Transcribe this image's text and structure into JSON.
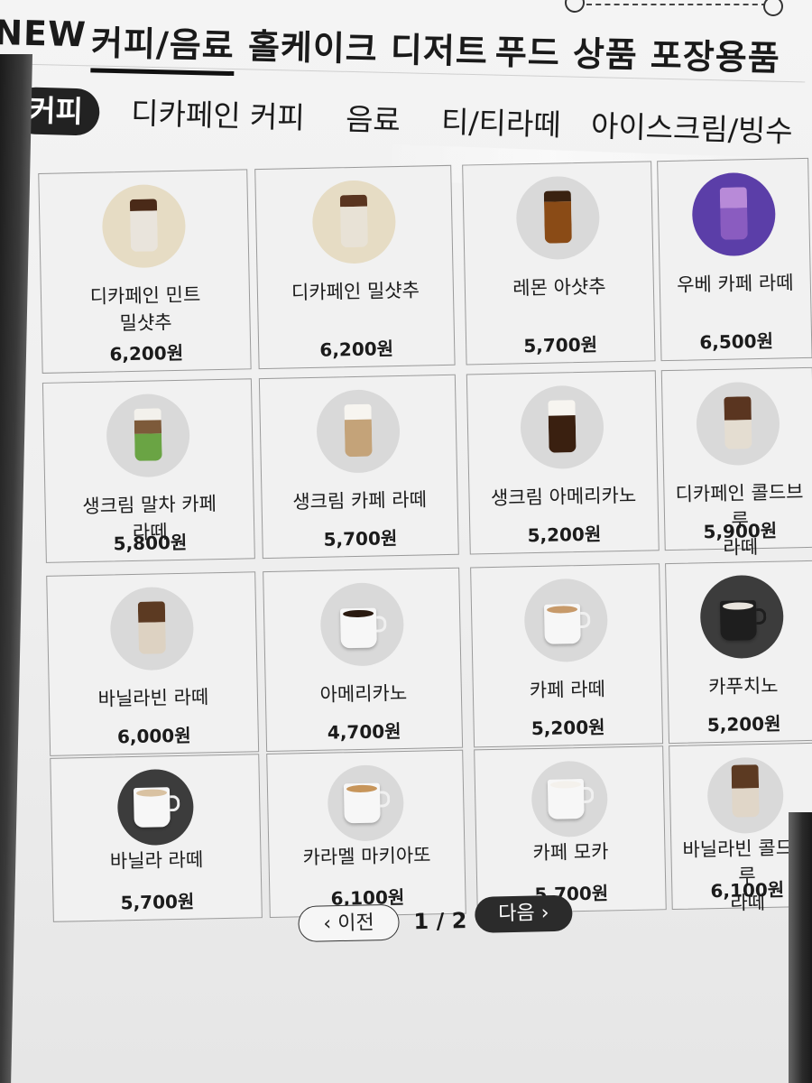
{
  "top_nav": {
    "items": [
      {
        "label": "NEW"
      },
      {
        "label": "커피/음료",
        "active": true
      },
      {
        "label": "홀케이크"
      },
      {
        "label": "디저트"
      },
      {
        "label": "푸드"
      },
      {
        "label": "상품"
      },
      {
        "label": "포장용품"
      }
    ]
  },
  "sub_nav": {
    "items": [
      {
        "label": "커피",
        "active": true
      },
      {
        "label": "디카페인 커피"
      },
      {
        "label": "음료"
      },
      {
        "label": "티/티라떼"
      },
      {
        "label": "아이스크림/빙수"
      }
    ]
  },
  "products": [
    {
      "name_lines": [
        "디카페인 민트",
        "밀샷추"
      ],
      "price": "6,200원",
      "icon": "iced-mint-latte-icon",
      "bg": "beige"
    },
    {
      "name_lines": [
        "디카페인 밀샷추"
      ],
      "price": "6,200원",
      "icon": "iced-milk-shot-icon",
      "bg": "beige"
    },
    {
      "name_lines": [
        "레몬 아샷추"
      ],
      "price": "5,700원",
      "icon": "iced-lemon-tea-icon",
      "bg": "grey"
    },
    {
      "name_lines": [
        "우베 카페 라떼"
      ],
      "price": "6,500원",
      "icon": "iced-ube-latte-icon",
      "bg": "purple"
    },
    {
      "name_lines": [
        "생크림 말차 카페",
        "라떼"
      ],
      "price": "5,800원",
      "icon": "matcha-latte-icon",
      "bg": "grey"
    },
    {
      "name_lines": [
        "생크림 카페 라떼"
      ],
      "price": "5,700원",
      "icon": "cream-latte-icon",
      "bg": "grey"
    },
    {
      "name_lines": [
        "생크림 아메리카노"
      ],
      "price": "5,200원",
      "icon": "cream-americano-icon",
      "bg": "grey"
    },
    {
      "name_lines": [
        "디카페인 콜드브루",
        "라떼"
      ],
      "price": "5,900원",
      "icon": "cold-brew-latte-icon",
      "bg": "grey"
    },
    {
      "name_lines": [
        "바닐라빈 라떼"
      ],
      "price": "6,000원",
      "icon": "vanilla-bean-latte-icon",
      "bg": "grey"
    },
    {
      "name_lines": [
        "아메리카노"
      ],
      "price": "4,700원",
      "icon": "americano-mug-icon",
      "bg": "grey"
    },
    {
      "name_lines": [
        "카페 라떼"
      ],
      "price": "5,200원",
      "icon": "cafe-latte-mug-icon",
      "bg": "grey"
    },
    {
      "name_lines": [
        "카푸치노"
      ],
      "price": "5,200원",
      "icon": "cappuccino-mug-icon",
      "bg": "dark"
    },
    {
      "name_lines": [
        "바닐라 라떼"
      ],
      "price": "5,700원",
      "icon": "vanilla-latte-mug-icon",
      "bg": "dark"
    },
    {
      "name_lines": [
        "카라멜 마키아또"
      ],
      "price": "6,100원",
      "icon": "caramel-macchiato-mug-icon",
      "bg": "grey"
    },
    {
      "name_lines": [
        "카페 모카"
      ],
      "price": "5,700원",
      "icon": "cafe-mocha-mug-icon",
      "bg": "grey"
    },
    {
      "name_lines": [
        "바닐라빈 콜드브루",
        "라떼"
      ],
      "price": "6,100원",
      "icon": "vanilla-cold-brew-icon",
      "bg": "grey"
    }
  ],
  "pagination": {
    "prev_label": "‹ 이전",
    "page_label": "1 / 2",
    "next_label": "다음 ›"
  }
}
